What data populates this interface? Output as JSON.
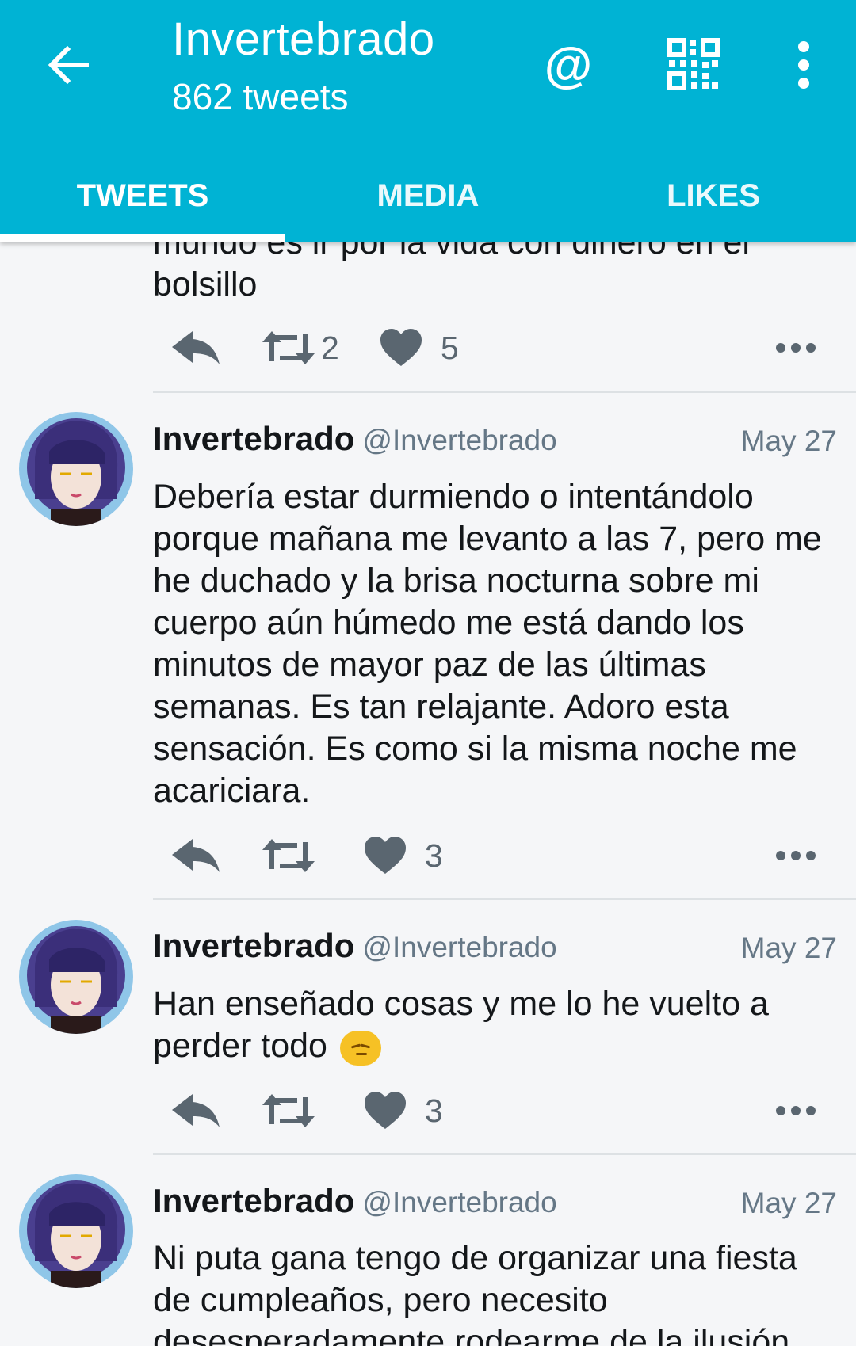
{
  "header": {
    "title": "Invertebrado",
    "subtitle": "862 tweets",
    "mention_symbol": "@",
    "icons": [
      "back-arrow-icon",
      "mention-icon",
      "qr-code-icon",
      "more-vert-icon"
    ],
    "color": "#00b3d4"
  },
  "tabs": [
    {
      "label": "TWEETS",
      "active": true
    },
    {
      "label": "MEDIA",
      "active": false
    },
    {
      "label": "LIKES",
      "active": false
    }
  ],
  "tweets": [
    {
      "text": "mundo es ir por la vida con dinero en el bolsillo",
      "retweets": "2",
      "likes": "5"
    },
    {
      "name": "Invertebrado",
      "handle": "@Invertebrado",
      "date": "May 27",
      "text": "Debería estar durmiendo o intentándolo porque mañana me levanto a las 7, pero me he duchado y la brisa nocturna sobre mi cuerpo aún húmedo me está dando los minutos de mayor paz de las últimas semanas. Es tan relajante. Adoro esta sensación. Es como si la misma noche me acariciara.",
      "retweets": "",
      "likes": "3"
    },
    {
      "name": "Invertebrado",
      "handle": "@Invertebrado",
      "date": "May 27",
      "text": "Han enseñado cosas y me lo he vuelto a perder todo",
      "emoji": "disappointed-face-emoji",
      "retweets": "",
      "likes": "3"
    },
    {
      "name": "Invertebrado",
      "handle": "@Invertebrado",
      "date": "May 27",
      "text": "Ni puta gana tengo de organizar una fiesta de cumpleaños, pero necesito desesperadamente rodearme de la ilusión"
    }
  ]
}
